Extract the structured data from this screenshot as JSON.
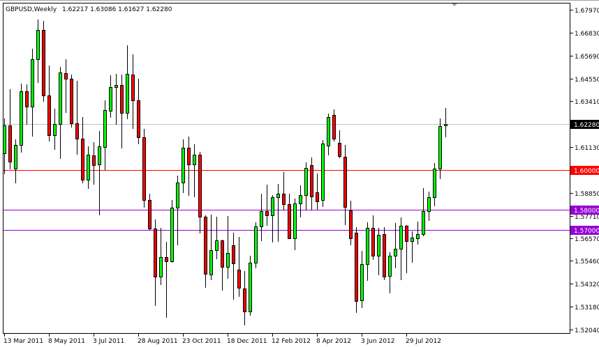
{
  "header": {
    "symbol_timeframe": "GBPUSD,Weekly",
    "ohlc_readout": "1.62217 1.63086 1.61627 1.62280"
  },
  "colors": {
    "bull": "#00ff00",
    "bear": "#ff0000",
    "outline": "#000000",
    "current_price_line": "#c0c0c0",
    "current_price_label_bg": "#000000"
  },
  "chart_data": {
    "type": "candlestick",
    "title": "GBPUSD,Weekly",
    "xlabel": "",
    "ylabel": "",
    "ylim": [
      1.5204,
      1.6797
    ],
    "grid": false,
    "start_week": "13 Mar 2011",
    "interval": "weekly",
    "x_tick_labels": [
      {
        "index": 0,
        "label": "13 Mar 2011"
      },
      {
        "index": 8,
        "label": "8 May 2011"
      },
      {
        "index": 16,
        "label": "3 Jul 2011"
      },
      {
        "index": 24,
        "label": "28 Aug 2011"
      },
      {
        "index": 32,
        "label": "23 Oct 2011"
      },
      {
        "index": 40,
        "label": "18 Dec 2011"
      },
      {
        "index": 48,
        "label": "12 Feb 2012"
      },
      {
        "index": 56,
        "label": "8 Apr 2012"
      },
      {
        "index": 64,
        "label": "3 Jun 2012"
      },
      {
        "index": 72,
        "label": "29 Jul 2012"
      }
    ],
    "y_tick_labels": [
      "1.67970",
      "1.66830",
      "1.65690",
      "1.64550",
      "1.63410",
      "1.61130",
      "1.58850",
      "1.57710",
      "1.56570",
      "1.55460",
      "1.54320",
      "1.53180",
      "1.52040"
    ],
    "levels": [
      {
        "value": 1.6228,
        "label": "1.62280",
        "color": "#c0c0c0",
        "label_bg": "#000000",
        "label_fg": "#ffffff"
      },
      {
        "value": 1.6,
        "label": "1.60000",
        "color": "#ff0000",
        "label_bg": "#ff0000",
        "label_fg": "#ffffff"
      },
      {
        "value": 1.58,
        "label": "1.58000",
        "color": "#9400d3",
        "label_bg": "#9400d3",
        "label_fg": "#ffffff"
      },
      {
        "value": 1.57,
        "label": "1.57000",
        "color": "#9400d3",
        "label_bg": "#9400d3",
        "label_fg": "#ffffff"
      }
    ],
    "fields": [
      "open",
      "high",
      "low",
      "close"
    ],
    "candles": [
      [
        1.6082,
        1.6255,
        1.5978,
        1.6221
      ],
      [
        1.6221,
        1.6401,
        1.6002,
        1.604
      ],
      [
        1.6005,
        1.6151,
        1.5932,
        1.6123
      ],
      [
        1.6123,
        1.6429,
        1.6085,
        1.6391
      ],
      [
        1.6391,
        1.6425,
        1.6224,
        1.6314
      ],
      [
        1.6314,
        1.6603,
        1.6165,
        1.655
      ],
      [
        1.655,
        1.6748,
        1.6432,
        1.6696
      ],
      [
        1.6696,
        1.6741,
        1.6339,
        1.637
      ],
      [
        1.637,
        1.6519,
        1.6141,
        1.6172
      ],
      [
        1.6172,
        1.6304,
        1.6099,
        1.6228
      ],
      [
        1.6228,
        1.6512,
        1.6054,
        1.6485
      ],
      [
        1.6481,
        1.655,
        1.6283,
        1.6453
      ],
      [
        1.6453,
        1.6474,
        1.621,
        1.6231
      ],
      [
        1.6231,
        1.6443,
        1.6075,
        1.6155
      ],
      [
        1.6155,
        1.6262,
        1.5932,
        1.595
      ],
      [
        1.595,
        1.6116,
        1.5905,
        1.6075
      ],
      [
        1.6071,
        1.6137,
        1.5926,
        1.6023
      ],
      [
        1.6026,
        1.6193,
        1.5773,
        1.6116
      ],
      [
        1.6113,
        1.6346,
        1.5998,
        1.6297
      ],
      [
        1.6294,
        1.6471,
        1.6259,
        1.6412
      ],
      [
        1.6412,
        1.6478,
        1.6224,
        1.6422
      ],
      [
        1.6422,
        1.6474,
        1.6106,
        1.6283
      ],
      [
        1.6283,
        1.662,
        1.6252,
        1.6478
      ],
      [
        1.6474,
        1.6575,
        1.6203,
        1.6346
      ],
      [
        1.6346,
        1.6453,
        1.6127,
        1.6162
      ],
      [
        1.6162,
        1.6203,
        1.5811,
        1.5849
      ],
      [
        1.5849,
        1.588,
        1.57,
        1.5707
      ],
      [
        1.5707,
        1.5752,
        1.5321,
        1.5467
      ],
      [
        1.5467,
        1.571,
        1.5426,
        1.5564
      ],
      [
        1.5564,
        1.5641,
        1.5262,
        1.5544
      ],
      [
        1.5544,
        1.5849,
        1.5537,
        1.5811
      ],
      [
        1.5811,
        1.5971,
        1.5623,
        1.5936
      ],
      [
        1.5936,
        1.6151,
        1.5884,
        1.611
      ],
      [
        1.611,
        1.6165,
        1.587,
        1.6026
      ],
      [
        1.6026,
        1.6127,
        1.5863,
        1.6075
      ],
      [
        1.6075,
        1.6089,
        1.5682,
        1.5766
      ],
      [
        1.5766,
        1.5773,
        1.5412,
        1.5481
      ],
      [
        1.5478,
        1.5776,
        1.545,
        1.5599
      ],
      [
        1.5599,
        1.5766,
        1.5554,
        1.5648
      ],
      [
        1.5648,
        1.5651,
        1.5398,
        1.5516
      ],
      [
        1.5516,
        1.5769,
        1.5457,
        1.5585
      ],
      [
        1.5623,
        1.5686,
        1.5353,
        1.5533
      ],
      [
        1.5502,
        1.5665,
        1.5367,
        1.5412
      ],
      [
        1.5408,
        1.5495,
        1.5224,
        1.5294
      ],
      [
        1.5294,
        1.5571,
        1.5273,
        1.5537
      ],
      [
        1.5537,
        1.5738,
        1.5509,
        1.5717
      ],
      [
        1.5717,
        1.588,
        1.5644,
        1.5794
      ],
      [
        1.5794,
        1.5926,
        1.5721,
        1.5773
      ],
      [
        1.5773,
        1.5873,
        1.5637,
        1.5863
      ],
      [
        1.5863,
        1.5929,
        1.5641,
        1.588
      ],
      [
        1.588,
        1.5988,
        1.5797,
        1.5828
      ],
      [
        1.5828,
        1.588,
        1.5655,
        1.5658
      ],
      [
        1.5658,
        1.5856,
        1.5599,
        1.5832
      ],
      [
        1.5832,
        1.5922,
        1.5762,
        1.5873
      ],
      [
        1.5873,
        1.6037,
        1.5797,
        1.6009
      ],
      [
        1.6023,
        1.6061,
        1.5797,
        1.5867
      ],
      [
        1.5887,
        1.5981,
        1.58,
        1.5842
      ],
      [
        1.5849,
        1.6148,
        1.5814,
        1.613
      ],
      [
        1.612,
        1.628,
        1.6071,
        1.6262
      ],
      [
        1.6273,
        1.63,
        1.6141,
        1.6155
      ],
      [
        1.6134,
        1.6196,
        1.6057,
        1.6068
      ],
      [
        1.6064,
        1.6123,
        1.5724,
        1.5814
      ],
      [
        1.5797,
        1.5846,
        1.5623,
        1.5658
      ],
      [
        1.5686,
        1.5714,
        1.5287,
        1.5346
      ],
      [
        1.5349,
        1.5596,
        1.5311,
        1.553
      ],
      [
        1.553,
        1.5738,
        1.5446,
        1.571
      ],
      [
        1.571,
        1.5773,
        1.5551,
        1.5571
      ],
      [
        1.5571,
        1.571,
        1.5474,
        1.5676
      ],
      [
        1.5679,
        1.5714,
        1.545,
        1.5467
      ],
      [
        1.5471,
        1.5589,
        1.5384,
        1.5571
      ],
      [
        1.5571,
        1.5735,
        1.5509,
        1.5606
      ],
      [
        1.5606,
        1.5762,
        1.545,
        1.5721
      ],
      [
        1.5721,
        1.5724,
        1.5485,
        1.5644
      ],
      [
        1.5644,
        1.5693,
        1.5537,
        1.5662
      ],
      [
        1.5658,
        1.5742,
        1.5627,
        1.5679
      ],
      [
        1.5679,
        1.5908,
        1.5669,
        1.5794
      ],
      [
        1.5794,
        1.5891,
        1.5745,
        1.5863
      ],
      [
        1.5863,
        1.6033,
        1.5818,
        1.6005
      ],
      [
        1.6005,
        1.6255,
        1.5953,
        1.6217
      ],
      [
        1.62217,
        1.63086,
        1.61627,
        1.6228
      ]
    ]
  }
}
